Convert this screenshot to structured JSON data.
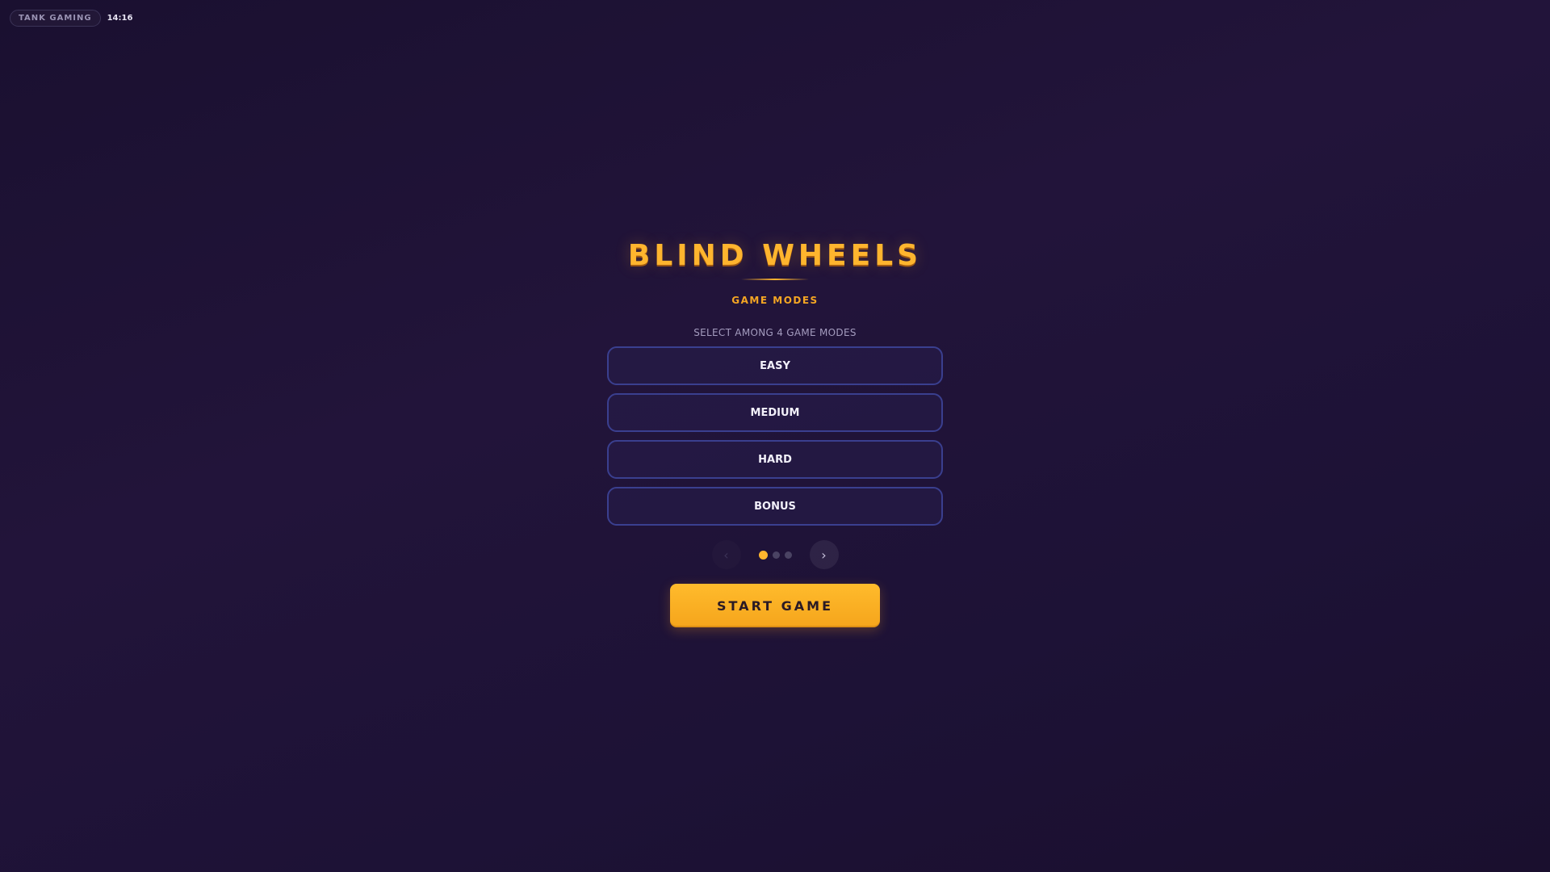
{
  "header": {
    "brand": "TANK GAMING",
    "time": "14:16"
  },
  "menu": {
    "title": "BLIND WHEELS",
    "subtitle": "GAME MODES",
    "hint": "SELECT AMONG 4 GAME MODES",
    "modes": [
      {
        "label": "EASY"
      },
      {
        "label": "MEDIUM"
      },
      {
        "label": "HARD"
      },
      {
        "label": "BONUS"
      }
    ],
    "pager": {
      "prev_icon": "chevron-left-icon",
      "next_icon": "chevron-right-icon",
      "pages": 3,
      "current_page": 1,
      "prev_glyph": "‹",
      "next_glyph": "›"
    },
    "start_label": "START GAME"
  },
  "colors": {
    "accent": "#ffb52e",
    "background": "#1d1236",
    "button_border": "#3a3f8f",
    "text": "#f2f0fa"
  }
}
